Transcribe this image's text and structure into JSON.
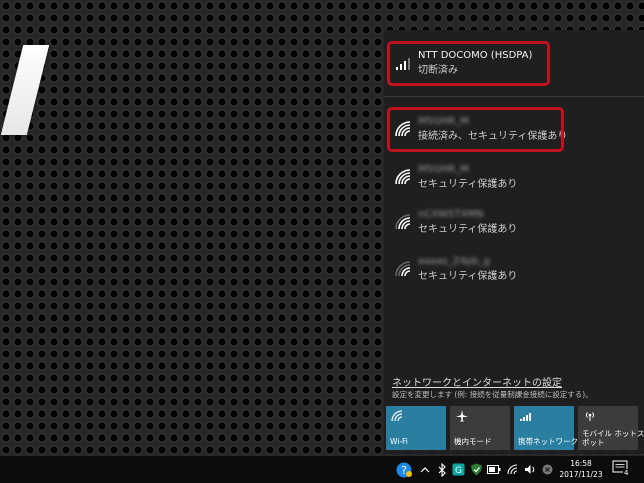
{
  "networks": [
    {
      "name": "NTT DOCOMO (HSDPA)",
      "status": "切断済み",
      "icon": "cellular-signal-icon"
    },
    {
      "name": "M5GHR_M",
      "status": "接続済み、セキュリティ保護あり",
      "icon": "wifi-signal-icon"
    },
    {
      "name": "M5GHR_M",
      "status": "セキュリティ保護あり",
      "icon": "wifi-signal-icon"
    },
    {
      "name": "nCXWSTXMN",
      "status": "セキュリティ保護あり",
      "icon": "wifi-signal-icon"
    },
    {
      "name": "aaaas_Z4pb_g",
      "status": "セキュリティ保護あり",
      "icon": "wifi-signal-icon"
    }
  ],
  "settings": {
    "link_label": "ネットワークとインターネットの設定",
    "description": "設定を変更します (例: 接続を従量制課金接続に設定する)。"
  },
  "quick_actions": [
    {
      "label": "Wi-Fi",
      "icon": "wifi-icon",
      "active": true
    },
    {
      "label": "機内モード",
      "icon": "airplane-icon",
      "active": false
    },
    {
      "label": "携帯ネットワーク",
      "icon": "cellular-icon",
      "active": true
    },
    {
      "label": "モバイル ホットスポット",
      "label_line1": "モバイル ホットス",
      "label_line2": "ポット",
      "icon": "hotspot-icon",
      "active": false
    }
  ],
  "taskbar": {
    "time": "16:58",
    "date": "2017/11/23",
    "notification_count": "4",
    "tray_icons": [
      "help-icon",
      "chevron-up-icon",
      "bluetooth-icon",
      "app-icon",
      "shield-icon",
      "battery-icon",
      "network-icon",
      "volume-icon",
      "close-icon"
    ]
  },
  "colors": {
    "highlight": "#c0111f",
    "tile_active": "#2a7fa1",
    "flyout_bg": "#1f1f1f"
  }
}
